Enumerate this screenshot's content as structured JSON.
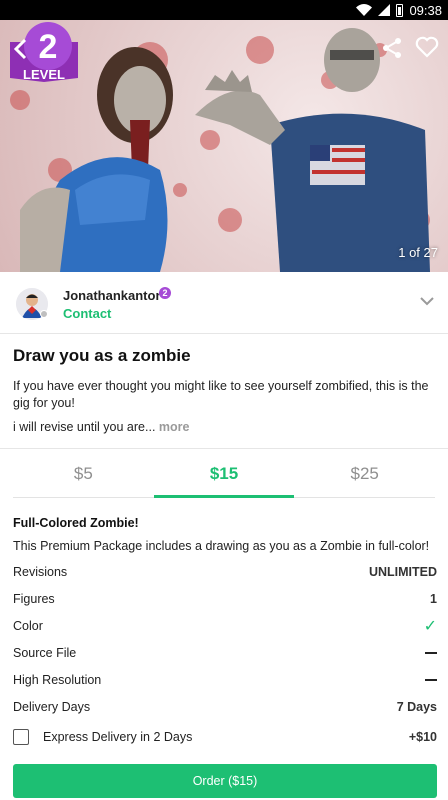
{
  "status_bar": {
    "time": "09:38",
    "icons": [
      "wifi-icon",
      "signal-icon",
      "battery-icon"
    ]
  },
  "hero": {
    "level_badge": {
      "number": "2",
      "label": "LEVEL"
    },
    "counter": "1 of 27",
    "icons": {
      "back": "back-arrow-icon",
      "share": "share-icon",
      "favorite": "heart-icon"
    }
  },
  "seller": {
    "name": "Jonathankantor",
    "level": "2",
    "contact_label": "Contact",
    "avatar_icon": "avatar-icon",
    "expand_icon": "chevron-down-icon"
  },
  "gig": {
    "title": "Draw you as a zombie",
    "description": "If you have ever thought you might like to see yourself zombified, this is the gig for you!",
    "excerpt": "i will revise until you are...",
    "more_label": "more"
  },
  "packages": {
    "tabs": [
      {
        "label": "$5"
      },
      {
        "label": "$15"
      },
      {
        "label": "$25"
      }
    ],
    "active_index": 1,
    "title": "Full-Colored Zombie!",
    "description": "This Premium Package includes a drawing as you as a Zombie in full-color!",
    "features": [
      {
        "label": "Revisions",
        "value": "UNLIMITED"
      },
      {
        "label": "Figures",
        "value": "1"
      },
      {
        "label": "Color",
        "value": "included"
      },
      {
        "label": "Source File",
        "value": "not included"
      },
      {
        "label": "High Resolution",
        "value": "not included"
      },
      {
        "label": "Delivery Days",
        "value": "7 Days"
      }
    ],
    "express": {
      "label": "Express Delivery in 2 Days",
      "price": "+$10",
      "checked": false
    }
  },
  "order_button": {
    "label": "Order ($15)"
  },
  "colors": {
    "accent": "#1dbf73",
    "level_purple": "#a64bd6",
    "text": "#222222",
    "muted": "#9a9a9a"
  }
}
